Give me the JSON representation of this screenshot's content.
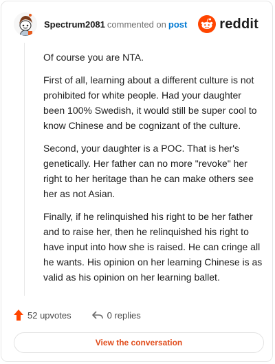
{
  "comment": {
    "username": "Spectrum2081",
    "commented_text": "commented on",
    "post_link": "post",
    "paragraphs": [
      "Of course you are NTA.",
      "First of all, learning about a different culture is not prohibited for white people. Had your daughter been 100% Swedish, it would still be super cool to know Chinese and be cognizant of the culture.",
      "Second, your daughter is a POC. That is her's genetically. Her father can no more \"revoke\" her right to her heritage than he can make others see her as not Asian.",
      "Finally, if he relinquished his right to be her father and to raise her, then he relinquished his right to have input into how she is raised. He can cringe all he wants. His opinion on her learning Chinese is as valid as his opinion on her learning ballet."
    ]
  },
  "brand": {
    "name": "reddit",
    "color": "#ff4500"
  },
  "actions": {
    "upvotes": "52 upvotes",
    "replies": "0 replies",
    "upvote_color": "#ff4500"
  },
  "view_button": "View the conversation",
  "icons": {
    "avatar": "snoo-avatar-icon",
    "logo": "reddit-snoo-icon",
    "upvote": "upvote-arrow-icon",
    "reply": "reply-arrow-icon"
  }
}
